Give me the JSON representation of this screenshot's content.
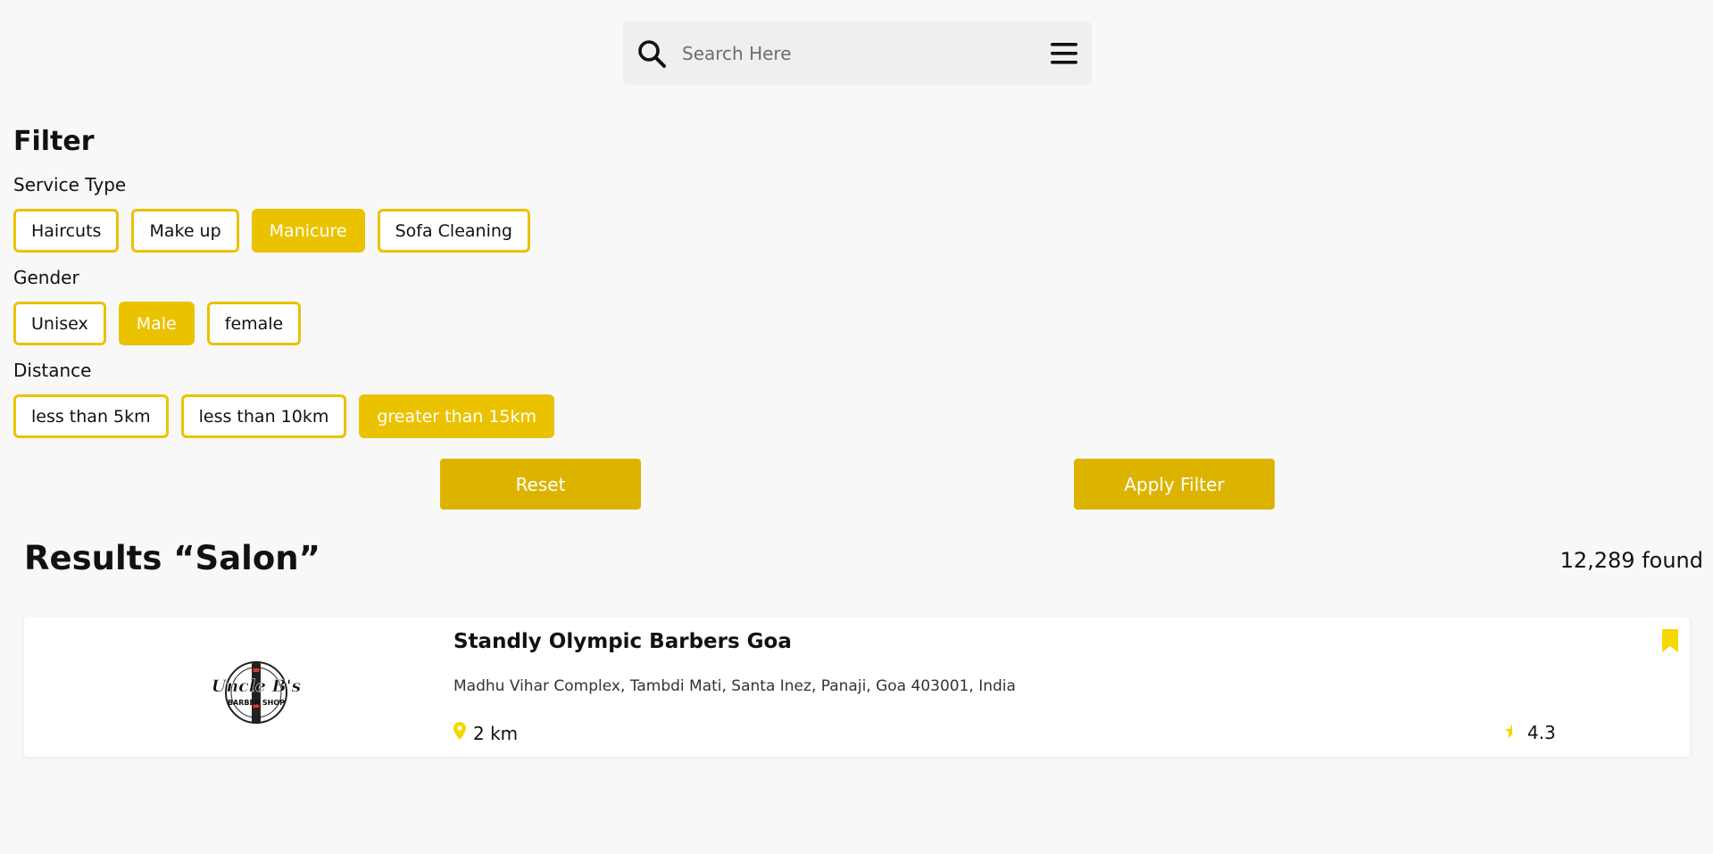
{
  "search": {
    "placeholder": "Search Here",
    "value": ""
  },
  "filter": {
    "title": "Filter",
    "groups": [
      {
        "label": "Service Type",
        "options": [
          {
            "label": "Haircuts",
            "selected": false
          },
          {
            "label": "Make up",
            "selected": false
          },
          {
            "label": "Manicure",
            "selected": true
          },
          {
            "label": "Sofa Cleaning",
            "selected": false
          }
        ]
      },
      {
        "label": "Gender",
        "options": [
          {
            "label": "Unisex",
            "selected": false
          },
          {
            "label": "Male",
            "selected": true
          },
          {
            "label": "female",
            "selected": false
          }
        ]
      },
      {
        "label": "Distance",
        "options": [
          {
            "label": "less than 5km",
            "selected": false
          },
          {
            "label": "less than 10km",
            "selected": false
          },
          {
            "label": "greater than 15km",
            "selected": true
          }
        ]
      }
    ],
    "reset_label": "Reset",
    "apply_label": "Apply Filter"
  },
  "results": {
    "title": "Results “Salon”",
    "count": "12,289 found",
    "items": [
      {
        "name": "Standly Olympic Barbers Goa",
        "address": "Madhu Vihar Complex, Tambdi Mati, Santa Inez, Panaji, Goa 403001, India",
        "distance": "2 km",
        "rating": "4.3",
        "logo_text": "Uncle B's",
        "logo_subtext": "BARBER SHOP"
      }
    ]
  },
  "colors": {
    "accent": "#ebc200",
    "button": "#dcb400",
    "marker": "#f5d800",
    "background": "#f8f8f8"
  },
  "icons": [
    "search-icon",
    "menu-icon",
    "location-pin-icon",
    "star-icon",
    "bookmark-icon"
  ]
}
